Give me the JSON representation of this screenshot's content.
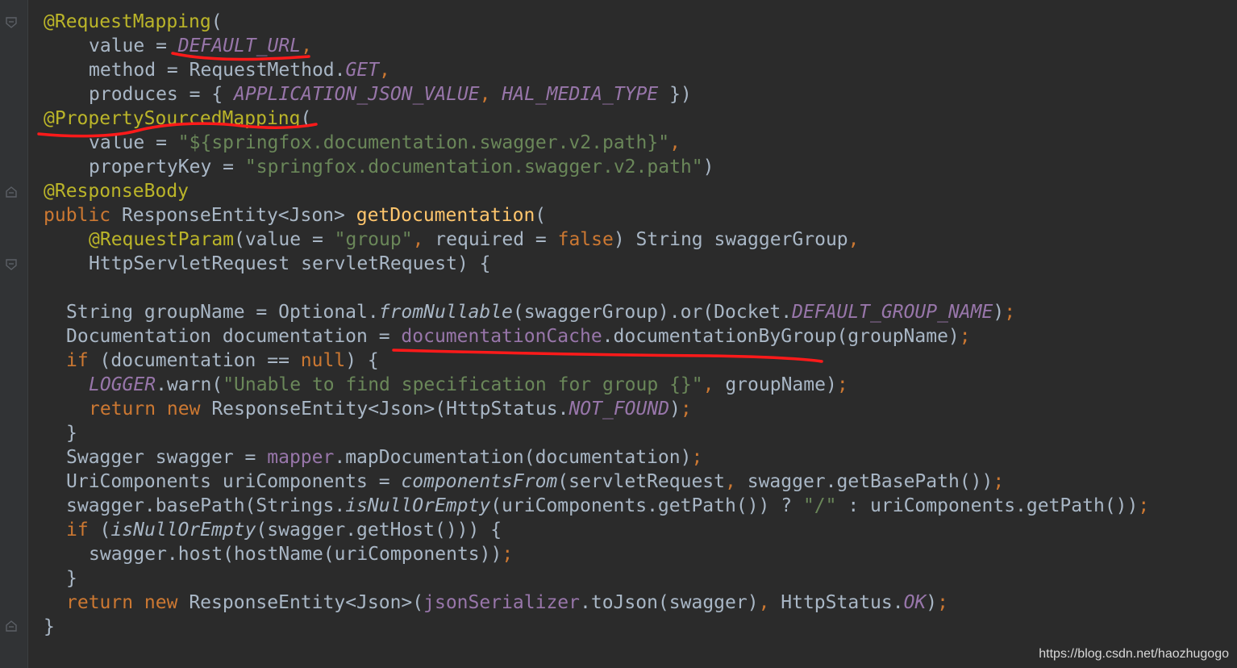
{
  "editor": {
    "lines": [
      {
        "indent": 0,
        "tokens": [
          [
            "annotation",
            "@RequestMapping"
          ],
          [
            "plain",
            "("
          ]
        ]
      },
      {
        "indent": 2,
        "tokens": [
          [
            "plain",
            "value = "
          ],
          [
            "constant",
            "DEFAULT_URL"
          ],
          [
            "punct",
            ","
          ]
        ]
      },
      {
        "indent": 2,
        "tokens": [
          [
            "plain",
            "method = RequestMethod."
          ],
          [
            "constant",
            "GET"
          ],
          [
            "punct",
            ","
          ]
        ]
      },
      {
        "indent": 2,
        "tokens": [
          [
            "plain",
            "produces = { "
          ],
          [
            "constant",
            "APPLICATION_JSON_VALUE"
          ],
          [
            "punct",
            ", "
          ],
          [
            "constant",
            "HAL_MEDIA_TYPE"
          ],
          [
            "plain",
            " })"
          ]
        ]
      },
      {
        "indent": 0,
        "tokens": [
          [
            "annotation",
            "@PropertySourcedMapping"
          ],
          [
            "plain",
            "("
          ]
        ]
      },
      {
        "indent": 2,
        "tokens": [
          [
            "plain",
            "value = "
          ],
          [
            "string",
            "\"${springfox.documentation.swagger.v2.path}\""
          ],
          [
            "punct",
            ","
          ]
        ]
      },
      {
        "indent": 2,
        "tokens": [
          [
            "plain",
            "propertyKey = "
          ],
          [
            "string",
            "\"springfox.documentation.swagger.v2.path\""
          ],
          [
            "plain",
            ")"
          ]
        ]
      },
      {
        "indent": 0,
        "tokens": [
          [
            "annotation",
            "@ResponseBody"
          ]
        ]
      },
      {
        "indent": 0,
        "tokens": [
          [
            "keyword",
            "public "
          ],
          [
            "plain",
            "ResponseEntity<Json> "
          ],
          [
            "method",
            "getDocumentation"
          ],
          [
            "plain",
            "("
          ]
        ]
      },
      {
        "indent": 2,
        "tokens": [
          [
            "annotation",
            "@RequestParam"
          ],
          [
            "plain",
            "(value = "
          ],
          [
            "string",
            "\"group\""
          ],
          [
            "punct",
            ", "
          ],
          [
            "plain",
            "required = "
          ],
          [
            "keyword",
            "false"
          ],
          [
            "plain",
            ") String swaggerGroup"
          ],
          [
            "punct",
            ","
          ]
        ]
      },
      {
        "indent": 2,
        "tokens": [
          [
            "plain",
            "HttpServletRequest servletRequest) {"
          ]
        ]
      },
      {
        "indent": 0,
        "tokens": []
      },
      {
        "indent": 1,
        "tokens": [
          [
            "plain",
            "String groupName = Optional."
          ],
          [
            "static",
            "fromNullable"
          ],
          [
            "plain",
            "(swaggerGroup).or(Docket."
          ],
          [
            "constant",
            "DEFAULT_GROUP_NAME"
          ],
          [
            "plain",
            ")"
          ],
          [
            "punct",
            ";"
          ]
        ]
      },
      {
        "indent": 1,
        "tokens": [
          [
            "plain",
            "Documentation documentation = "
          ],
          [
            "field",
            "documentationCache"
          ],
          [
            "plain",
            ".documentationByGroup(groupName)"
          ],
          [
            "punct",
            ";"
          ]
        ]
      },
      {
        "indent": 1,
        "tokens": [
          [
            "keyword",
            "if "
          ],
          [
            "plain",
            "(documentation == "
          ],
          [
            "keyword",
            "null"
          ],
          [
            "plain",
            ") {"
          ]
        ]
      },
      {
        "indent": 2,
        "tokens": [
          [
            "constant",
            "LOGGER"
          ],
          [
            "plain",
            ".warn("
          ],
          [
            "string",
            "\"Unable to find specification for group {}\""
          ],
          [
            "punct",
            ", "
          ],
          [
            "plain",
            "groupName)"
          ],
          [
            "punct",
            ";"
          ]
        ]
      },
      {
        "indent": 2,
        "tokens": [
          [
            "keyword",
            "return new "
          ],
          [
            "plain",
            "ResponseEntity<Json>(HttpStatus."
          ],
          [
            "constant",
            "NOT_FOUND"
          ],
          [
            "plain",
            ")"
          ],
          [
            "punct",
            ";"
          ]
        ]
      },
      {
        "indent": 1,
        "tokens": [
          [
            "plain",
            "}"
          ]
        ]
      },
      {
        "indent": 1,
        "tokens": [
          [
            "plain",
            "Swagger swagger = "
          ],
          [
            "field",
            "mapper"
          ],
          [
            "plain",
            ".mapDocumentation(documentation)"
          ],
          [
            "punct",
            ";"
          ]
        ]
      },
      {
        "indent": 1,
        "tokens": [
          [
            "plain",
            "UriComponents uriComponents = "
          ],
          [
            "static",
            "componentsFrom"
          ],
          [
            "plain",
            "(servletRequest"
          ],
          [
            "punct",
            ", "
          ],
          [
            "plain",
            "swagger.getBasePath())"
          ],
          [
            "punct",
            ";"
          ]
        ]
      },
      {
        "indent": 1,
        "tokens": [
          [
            "plain",
            "swagger.basePath(Strings."
          ],
          [
            "static",
            "isNullOrEmpty"
          ],
          [
            "plain",
            "(uriComponents.getPath()) ? "
          ],
          [
            "string",
            "\"/\""
          ],
          [
            "plain",
            " : uriComponents.getPath())"
          ],
          [
            "punct",
            ";"
          ]
        ]
      },
      {
        "indent": 1,
        "tokens": [
          [
            "keyword",
            "if "
          ],
          [
            "plain",
            "("
          ],
          [
            "static",
            "isNullOrEmpty"
          ],
          [
            "plain",
            "(swagger.getHost())) {"
          ]
        ]
      },
      {
        "indent": 2,
        "tokens": [
          [
            "plain",
            "swagger.host(hostName(uriComponents))"
          ],
          [
            "punct",
            ";"
          ]
        ]
      },
      {
        "indent": 1,
        "tokens": [
          [
            "plain",
            "}"
          ]
        ]
      },
      {
        "indent": 1,
        "tokens": [
          [
            "keyword",
            "return new "
          ],
          [
            "plain",
            "ResponseEntity<Json>("
          ],
          [
            "field",
            "jsonSerializer"
          ],
          [
            "plain",
            ".toJson(swagger)"
          ],
          [
            "punct",
            ", "
          ],
          [
            "plain",
            "HttpStatus."
          ],
          [
            "constant",
            "OK"
          ],
          [
            "plain",
            ")"
          ],
          [
            "punct",
            ";"
          ]
        ]
      },
      {
        "indent": 0,
        "tokens": [
          [
            "plain",
            "}"
          ]
        ]
      }
    ]
  },
  "watermark": "https://blog.csdn.net/haozhugogo",
  "colors": {
    "background": "#2b2b2b",
    "annotation": "#bbb529",
    "keyword": "#cc7832",
    "constant": "#9876aa",
    "string": "#6a8759",
    "method": "#ffc66d",
    "plain": "#a9b7c6",
    "underline": "#ff1a1a"
  }
}
